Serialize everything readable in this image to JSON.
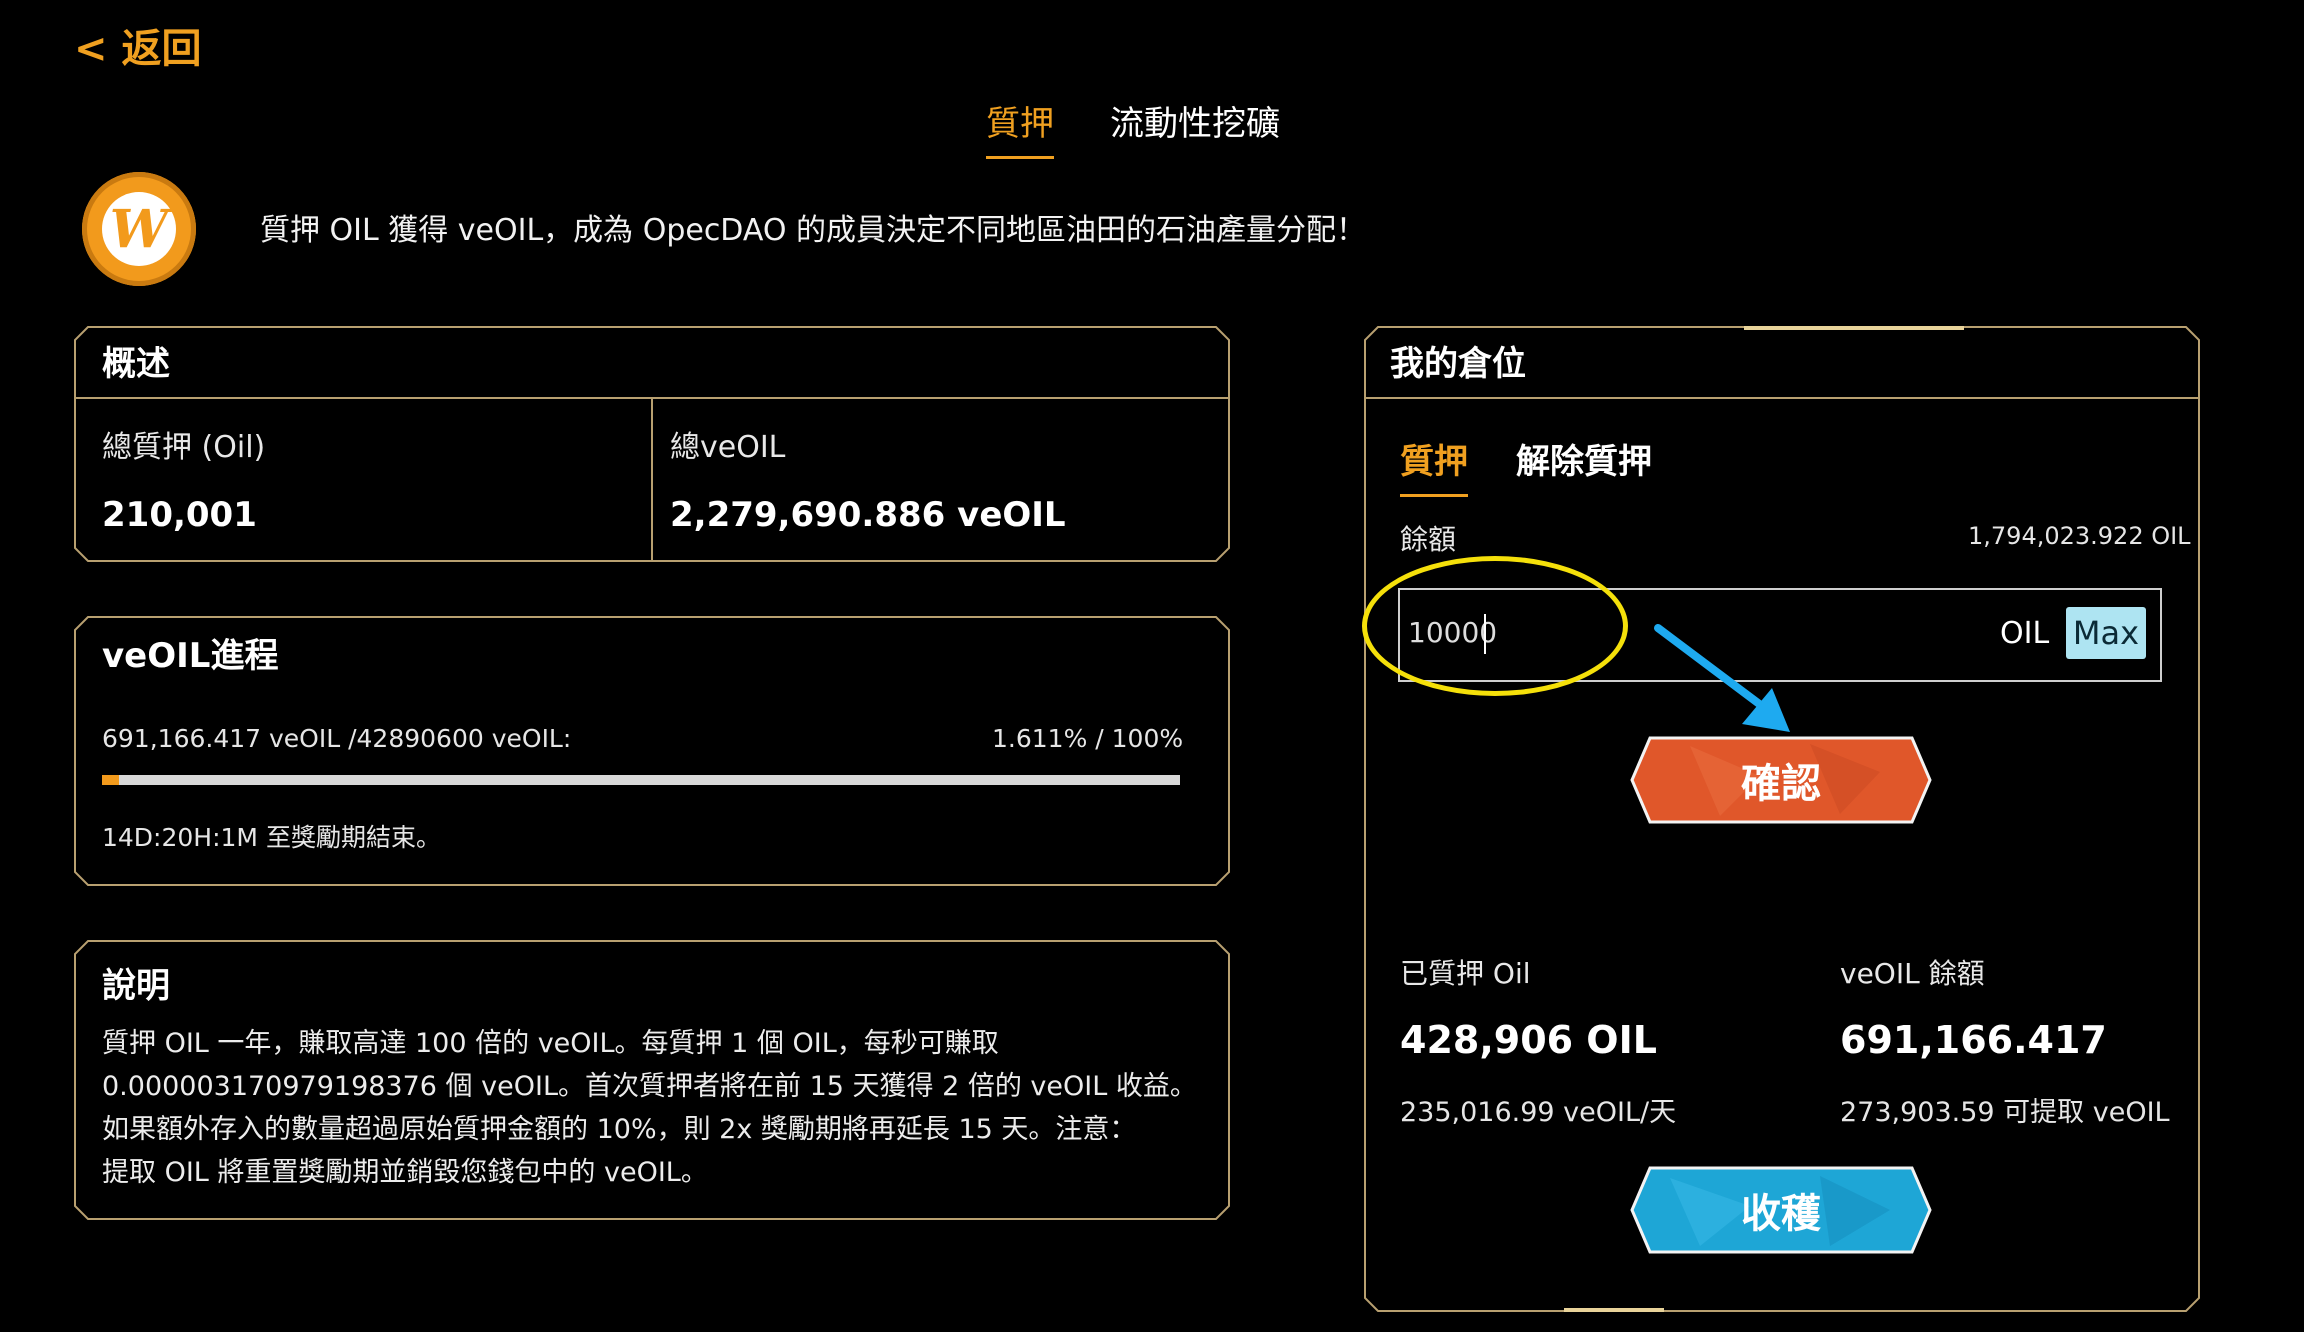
{
  "back": {
    "label": "< 返回"
  },
  "tabs": [
    {
      "label": "質押",
      "active": true
    },
    {
      "label": "流動性挖礦",
      "active": false
    }
  ],
  "intro_text": "質押 OIL 獲得 veOIL，成為 OpecDAO 的成員決定不同地區油田的石油產量分配！",
  "overview": {
    "title": "概述",
    "total_staked_label": "總質押 (Oil)",
    "total_staked_value": "210,001",
    "total_veoil_label": "總veOIL",
    "total_veoil_value": "2,279,690.886 veOIL"
  },
  "progress": {
    "title": "veOIL進程",
    "amount_text": "691,166.417 veOIL /42890600 veOIL:",
    "percent_text": "1.611% / 100%",
    "fraction": 0.01611,
    "countdown_text": "14D:20H:1M 至獎勵期結束。"
  },
  "description": {
    "title": "說明",
    "lines": [
      "質押 OIL 一年，賺取高達 100 倍的 veOIL。每質押 1 個 OIL，每秒可賺取",
      "0.000003170979198376 個 veOIL。首次質押者將在前 15 天獲得 2 倍的 veOIL 收益。",
      "如果額外存入的數量超過原始質押金額的 10%，則 2x 獎勵期將再延長 15 天。注意：",
      "提取 OIL 將重置獎勵期並銷毀您錢包中的 veOIL。"
    ]
  },
  "position": {
    "title": "我的倉位",
    "sub_tabs": [
      {
        "label": "質押",
        "active": true
      },
      {
        "label": "解除質押",
        "active": false
      }
    ],
    "balance_label": "餘額",
    "balance_value": "1,794,023.922 OIL",
    "input_value": "10000",
    "input_unit": "OIL",
    "max_label": "Max",
    "confirm_label": "確認",
    "staked_label": "已質押 Oil",
    "staked_value": "428,906 OIL",
    "staked_rate": "235,016.99 veOIL/天",
    "veoil_balance_label": "veOIL 餘額",
    "veoil_balance_value": "691,166.417",
    "claimable_text": "273,903.59 可提取 veOIL",
    "harvest_label": "收穫"
  },
  "colors": {
    "accent": "#f0a020",
    "frame": "#b8a070",
    "confirm_button": "#e0572a",
    "harvest_button": "#1ea6d6",
    "max_button": "#aee4f2",
    "highlight_ellipse": "#f5e00a",
    "arrow": "#1eaaf0"
  },
  "icons": {
    "logo": "w-coin-logo",
    "annotation_arrow": "arrow-down-right-icon"
  }
}
